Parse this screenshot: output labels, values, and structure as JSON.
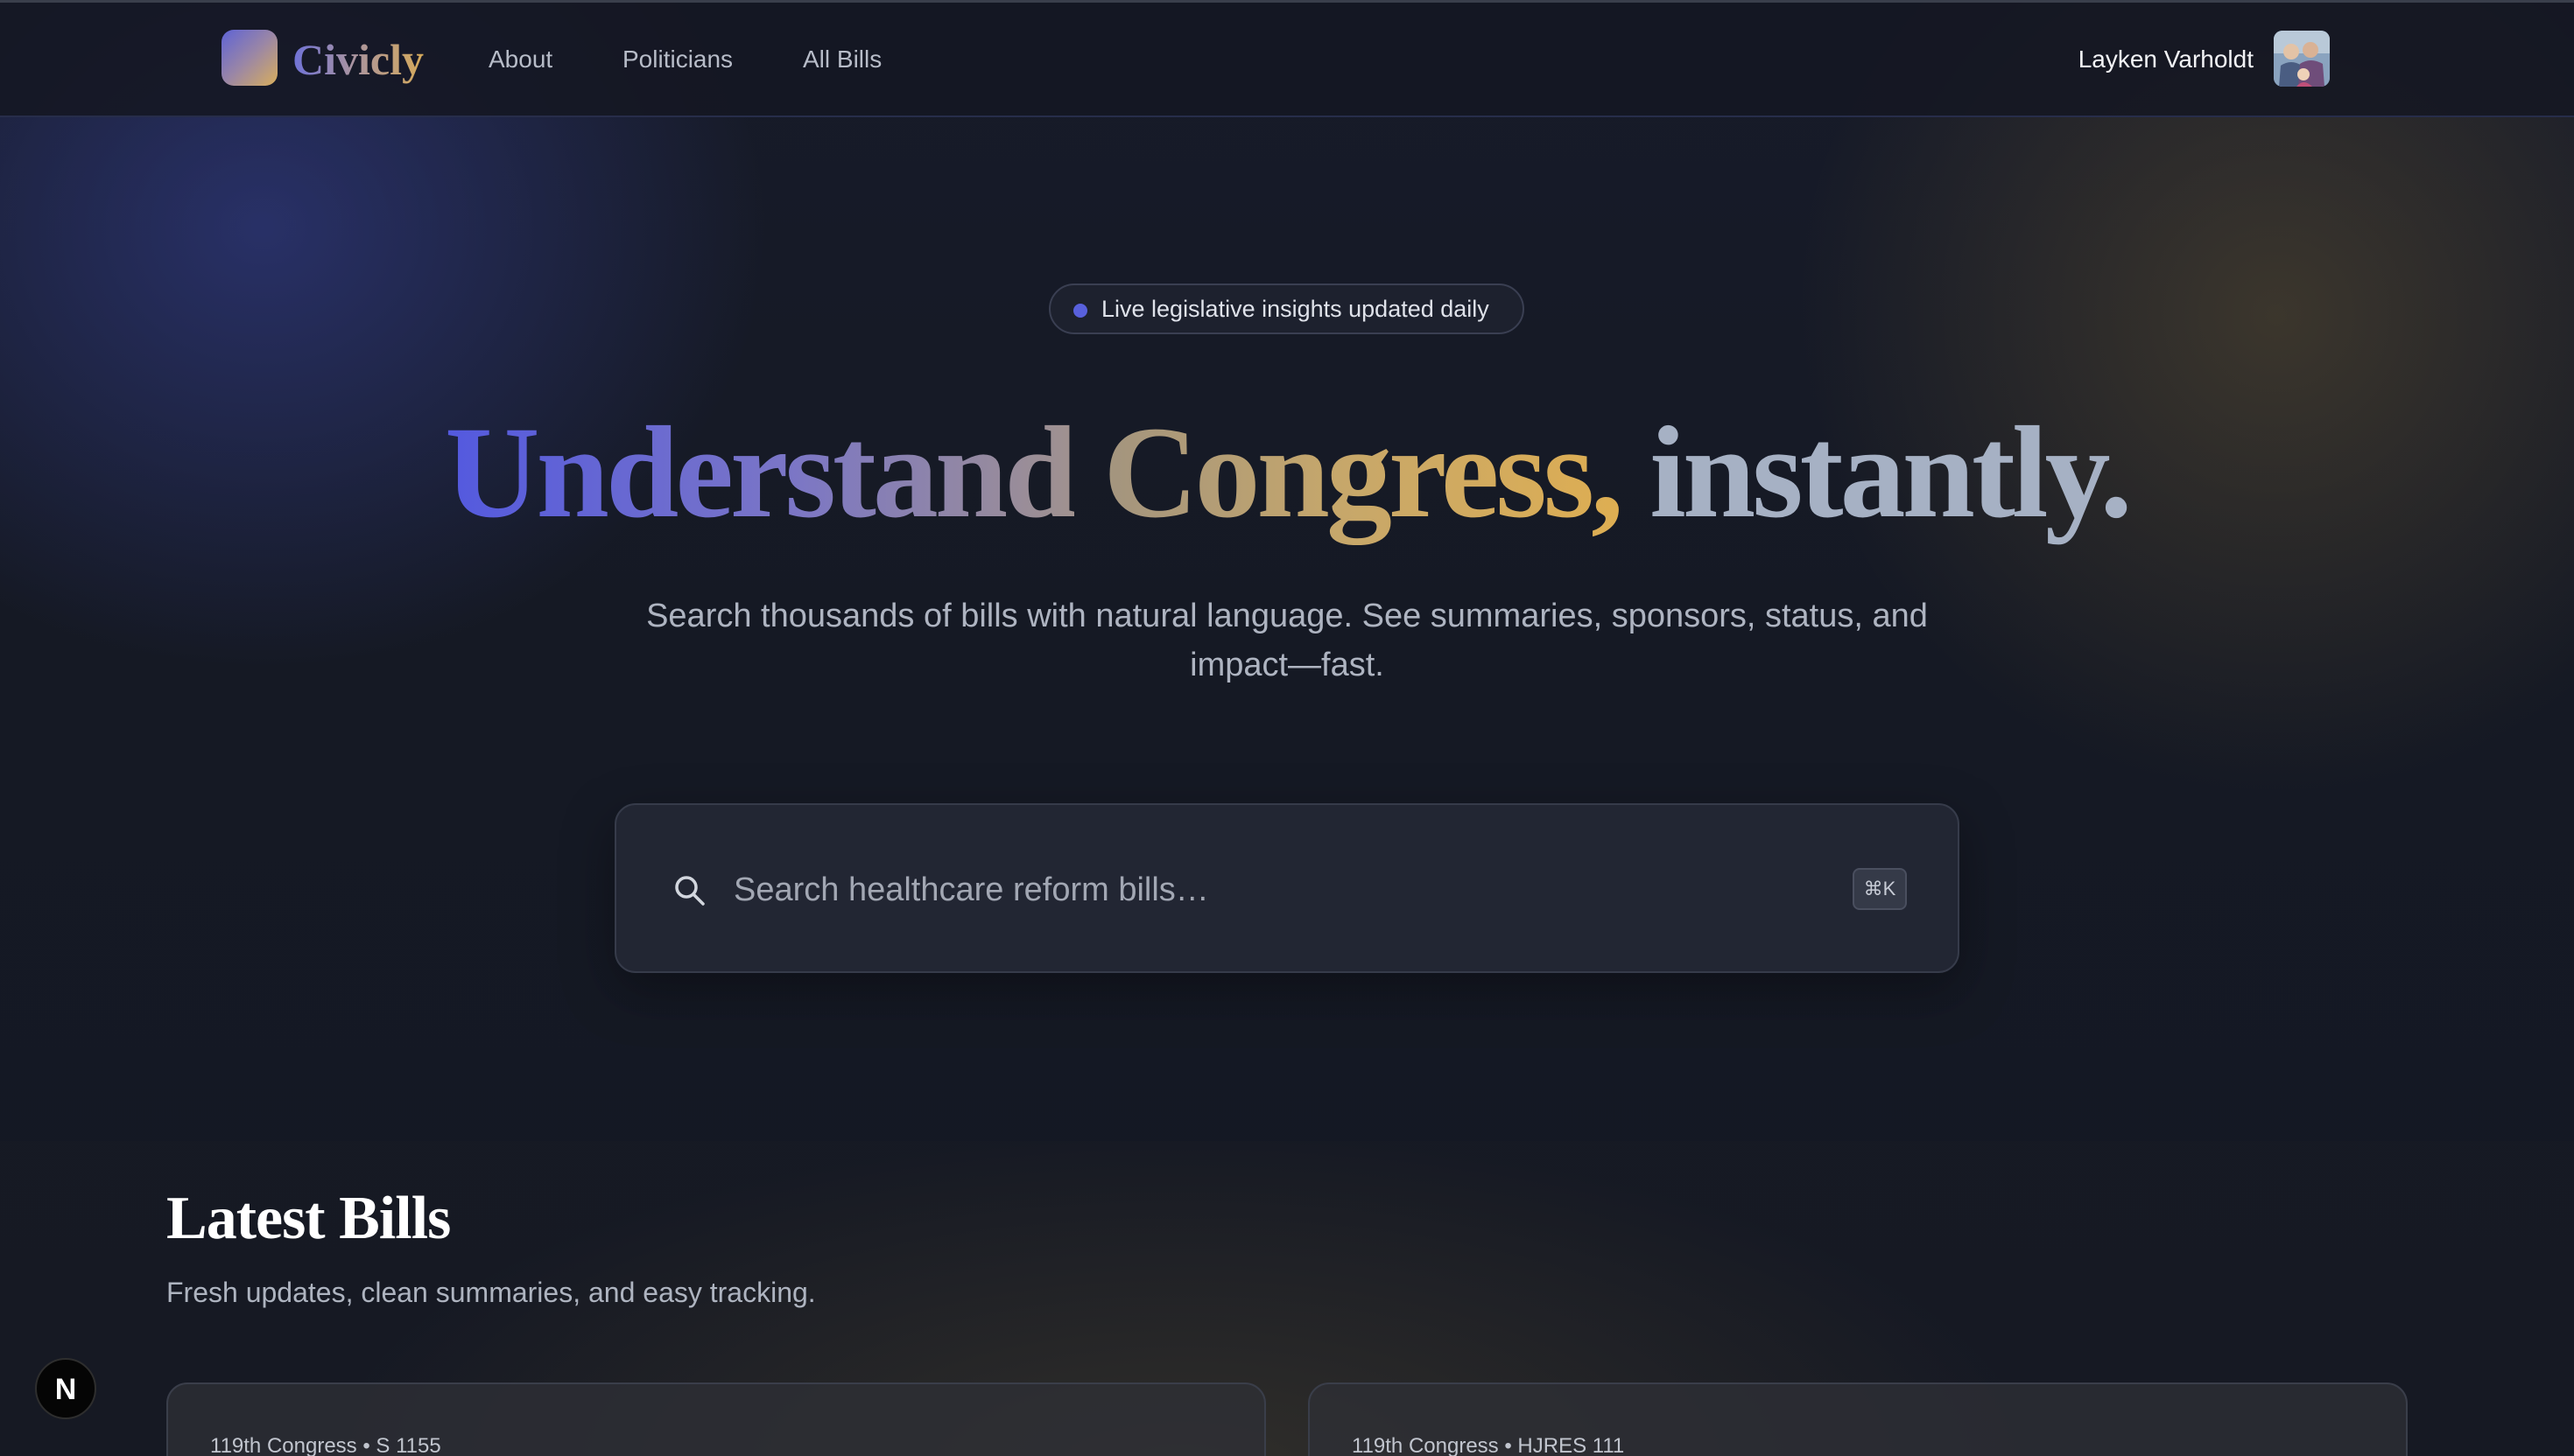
{
  "brand": {
    "name": "Civicly",
    "logo_icon": "gradient-square-logo-icon"
  },
  "nav": {
    "links": [
      "About",
      "Politicians",
      "All Bills"
    ]
  },
  "user": {
    "name": "Layken Varholdt",
    "avatar_icon": "user-avatar-photo"
  },
  "hero": {
    "badge_text": "Live legislative insights updated daily",
    "headline_part1": "Understand",
    "headline_part2": "Congress,",
    "headline_part3": "instantly.",
    "subtitle": "Search thousands of bills with natural language. See summaries, sponsors, status, and impact—fast."
  },
  "search": {
    "placeholder": "Search healthcare reform bills…",
    "value": "",
    "shortcut": "⌘K",
    "icon": "search-icon"
  },
  "latest": {
    "title": "Latest Bills",
    "subtitle": "Fresh updates, clean summaries, and easy tracking.",
    "bills": [
      {
        "meta": "119th Congress • S 1155"
      },
      {
        "meta": "119th Congress • HJRES 111"
      }
    ]
  },
  "dev_badge": {
    "letter": "N"
  },
  "colors": {
    "background": "#161a25",
    "accent_indigo": "#5860dc",
    "accent_gold": "#deae52",
    "headline_gray": "#a6b1c4"
  }
}
